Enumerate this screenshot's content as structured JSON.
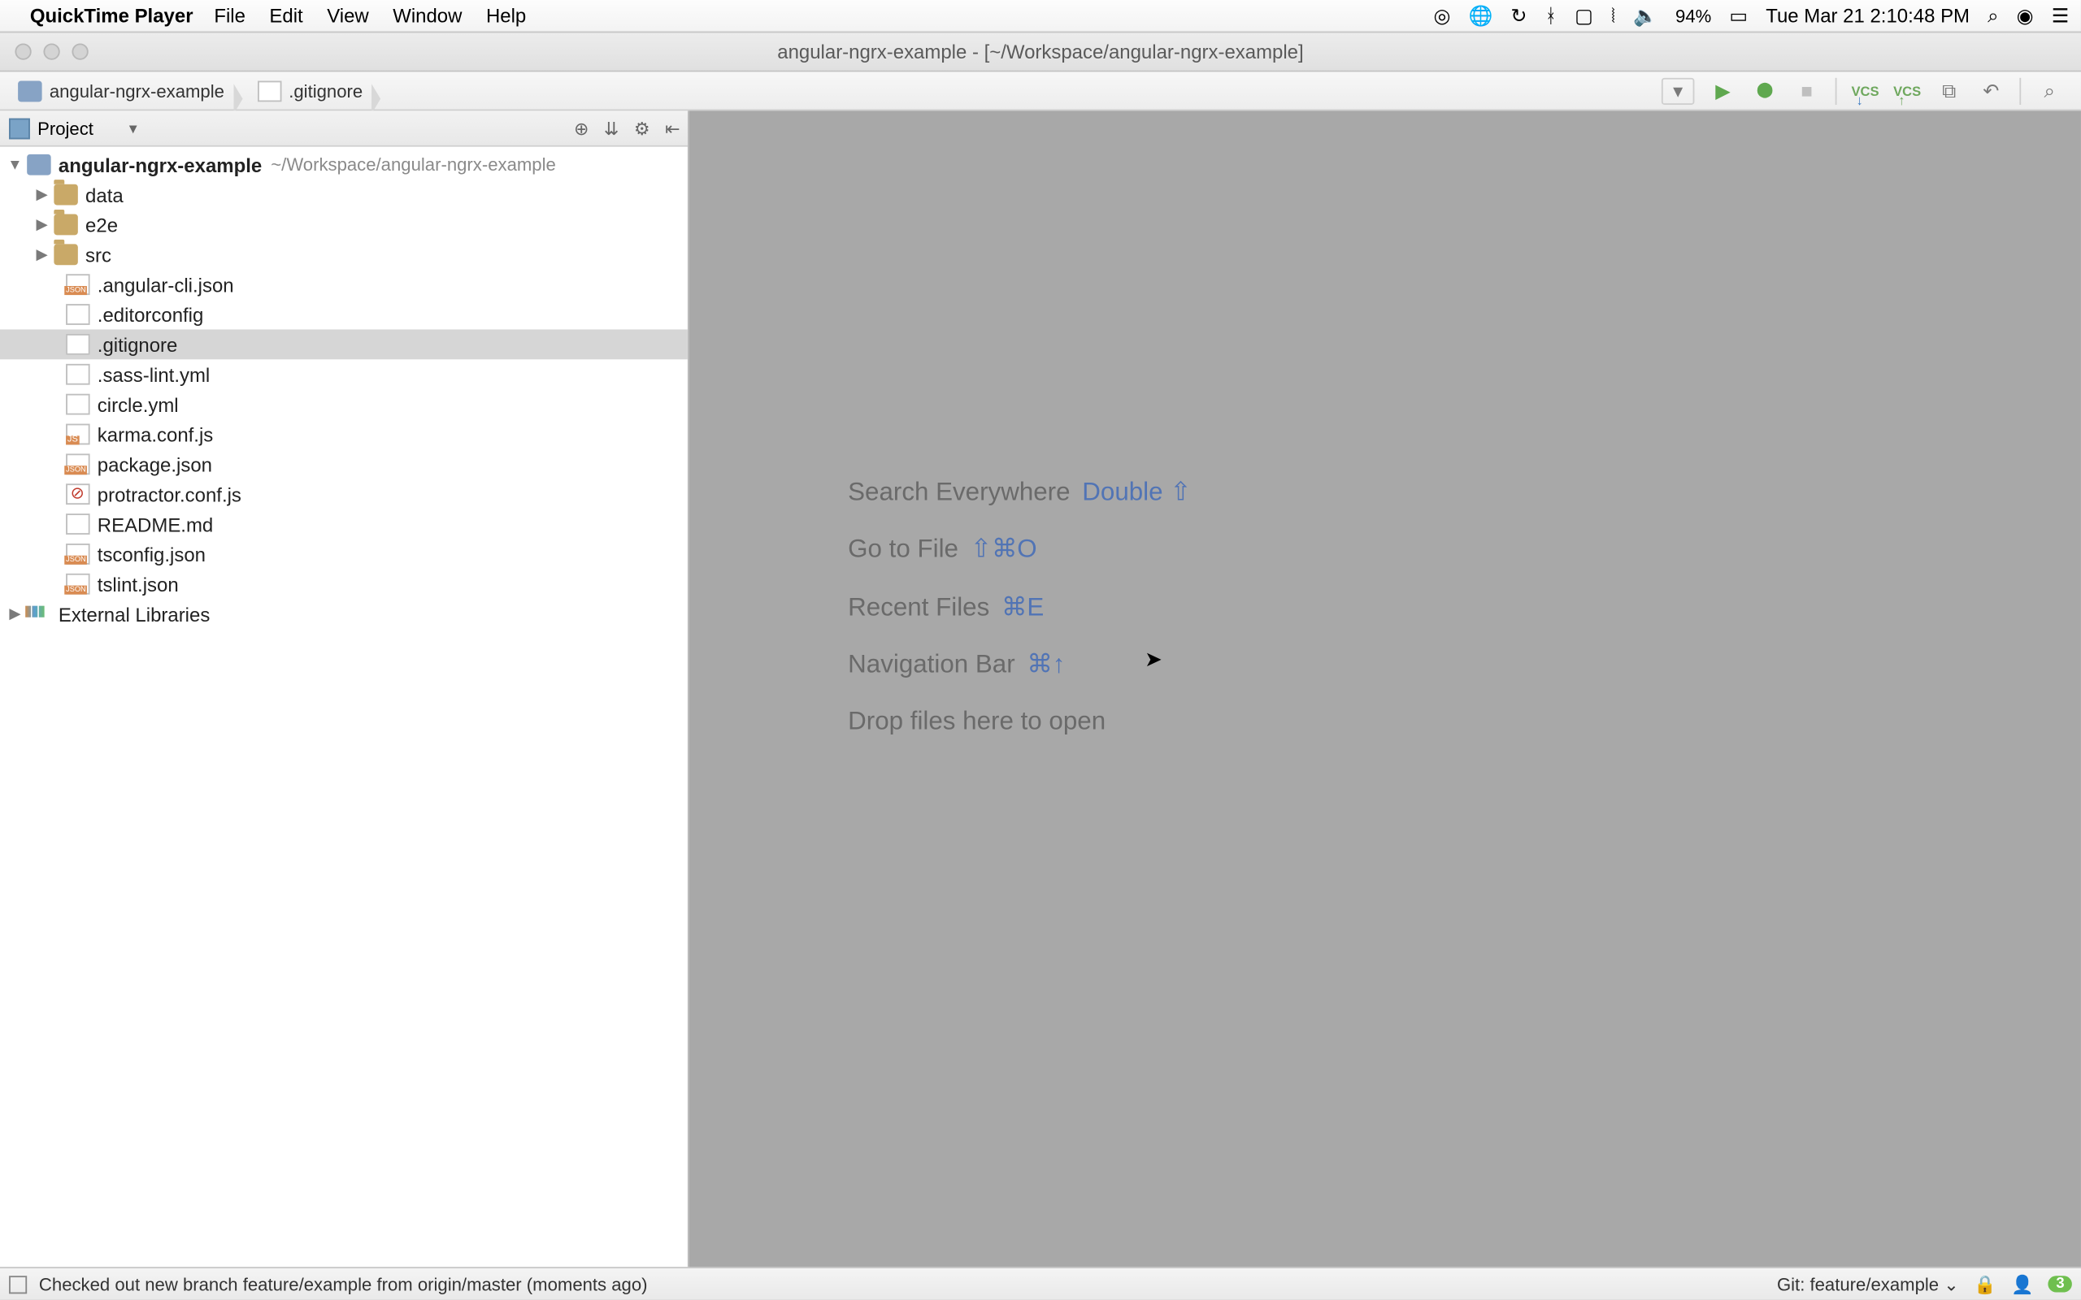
{
  "mac": {
    "app_name": "QuickTime Player",
    "menus": [
      "File",
      "Edit",
      "View",
      "Window",
      "Help"
    ],
    "battery_pct": "94%",
    "clock": "Tue Mar 21  2:10:48 PM"
  },
  "window": {
    "title": "angular-ngrx-example - [~/Workspace/angular-ngrx-example]"
  },
  "breadcrumb": {
    "root": "angular-ngrx-example",
    "file": ".gitignore"
  },
  "project_tool": {
    "label": "Project"
  },
  "tree": {
    "root_name": "angular-ngrx-example",
    "root_path": "~/Workspace/angular-ngrx-example",
    "children": [
      {
        "name": "data",
        "type": "folder",
        "expandable": true
      },
      {
        "name": "e2e",
        "type": "folder",
        "expandable": true
      },
      {
        "name": "src",
        "type": "folder",
        "expandable": true
      },
      {
        "name": ".angular-cli.json",
        "type": "json"
      },
      {
        "name": ".editorconfig",
        "type": "file"
      },
      {
        "name": ".gitignore",
        "type": "txt",
        "selected": true
      },
      {
        "name": ".sass-lint.yml",
        "type": "yml"
      },
      {
        "name": "circle.yml",
        "type": "yml"
      },
      {
        "name": "karma.conf.js",
        "type": "js"
      },
      {
        "name": "package.json",
        "type": "json"
      },
      {
        "name": "protractor.conf.js",
        "type": "block"
      },
      {
        "name": "README.md",
        "type": "txt"
      },
      {
        "name": "tsconfig.json",
        "type": "json"
      },
      {
        "name": "tslint.json",
        "type": "json"
      }
    ],
    "external_libraries": "External Libraries"
  },
  "editor_hints": {
    "lines": [
      {
        "label": "Search Everywhere",
        "shortcut": "Double ⇧"
      },
      {
        "label": "Go to File",
        "shortcut": "⇧⌘O"
      },
      {
        "label": "Recent Files",
        "shortcut": "⌘E"
      },
      {
        "label": "Navigation Bar",
        "shortcut": "⌘↑"
      },
      {
        "label": "Drop files here to open",
        "shortcut": ""
      }
    ]
  },
  "statusbar": {
    "message": "Checked out new branch feature/example from origin/master (moments ago)",
    "git": "Git: feature/example ⌄",
    "badge": "3"
  },
  "toolbar_icons": {
    "run_config_dd": "▾",
    "run": "▶",
    "debug": "⬤",
    "stop": "■",
    "vcs_update": "VCS",
    "vcs_commit": "VCS",
    "undo": "↶",
    "search": "⌕"
  }
}
